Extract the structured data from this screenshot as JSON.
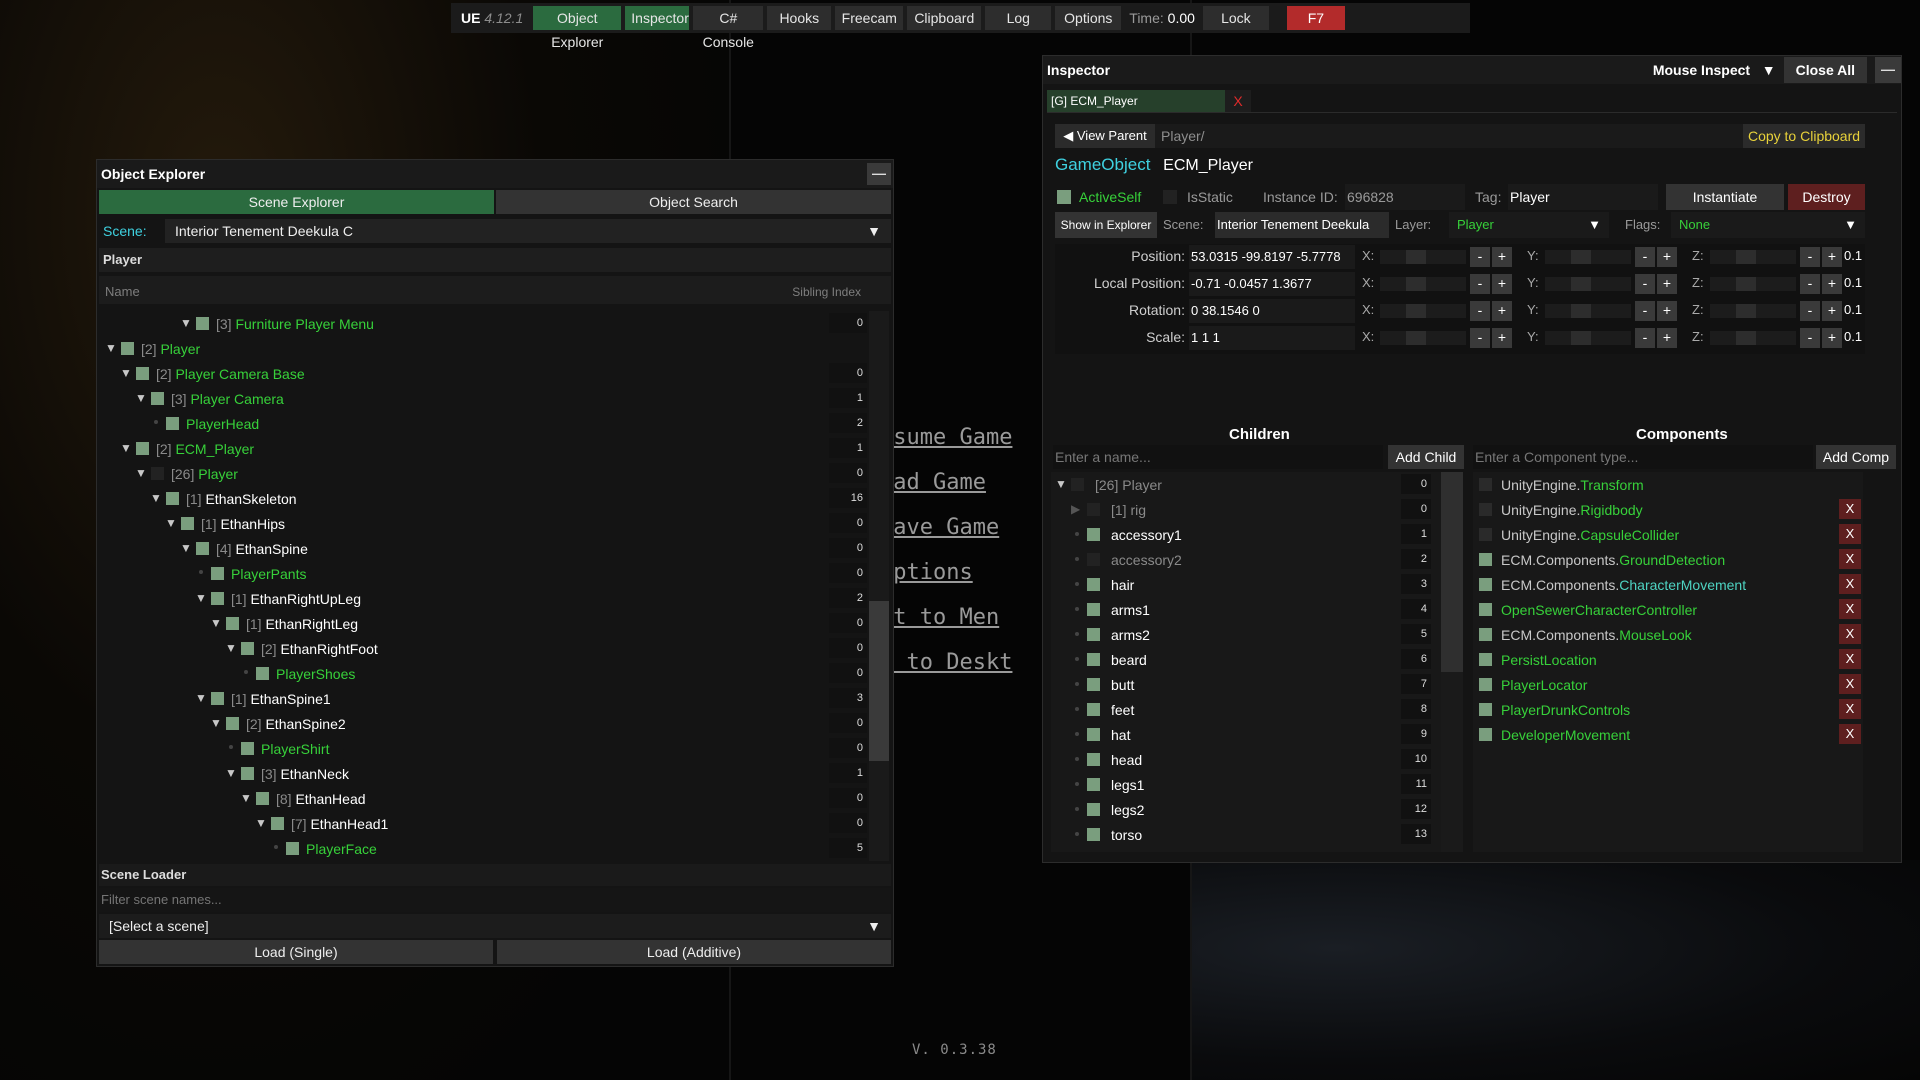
{
  "game_menu": {
    "items": [
      "esume Game",
      "oad Game",
      "Save Game",
      "Options",
      "it to Men",
      "t to Deskt"
    ],
    "version": "V. 0.3.38"
  },
  "topbar": {
    "title": "UE",
    "version": "4.12.1",
    "buttons": [
      "Object Explorer",
      "Inspector",
      "C# Console",
      "Hooks",
      "Freecam",
      "Clipboard",
      "Log",
      "Options"
    ],
    "active_buttons": [
      "Object Explorer",
      "Inspector"
    ],
    "time_label": "Time:",
    "time_value": "0.00",
    "lock": "Lock",
    "close_key": "F7"
  },
  "object_explorer": {
    "title": "Object Explorer",
    "minimize": "—",
    "tabs": [
      "Scene Explorer",
      "Object Search"
    ],
    "scene_label": "Scene:",
    "scene_value": "Interior Tenement Deekula C",
    "dropdown_arrow": "▼",
    "section": "Player",
    "col_name": "Name",
    "col_sibling": "Sibling Index",
    "tree": [
      {
        "depth": 5,
        "expanded": true,
        "active": true,
        "count": "[3]",
        "name": "Furniture Player Menu",
        "green": true,
        "sib": "0"
      },
      {
        "depth": 0,
        "expanded": true,
        "active": true,
        "count": "[2]",
        "name": "Player",
        "green": true,
        "sib": ""
      },
      {
        "depth": 1,
        "expanded": true,
        "active": true,
        "count": "[2]",
        "name": "Player Camera Base",
        "green": true,
        "sib": "0"
      },
      {
        "depth": 2,
        "expanded": true,
        "active": true,
        "count": "[3]",
        "name": "Player Camera",
        "green": true,
        "sib": "1"
      },
      {
        "depth": 3,
        "expanded": null,
        "active": true,
        "count": "",
        "name": "PlayerHead",
        "green": true,
        "sib": "2"
      },
      {
        "depth": 1,
        "expanded": true,
        "active": true,
        "count": "[2]",
        "name": "ECM_Player",
        "green": true,
        "sib": "1"
      },
      {
        "depth": 2,
        "expanded": true,
        "active": false,
        "count": "[26]",
        "name": "Player",
        "green": true,
        "sib": "0"
      },
      {
        "depth": 3,
        "expanded": true,
        "active": true,
        "count": "[1]",
        "name": "EthanSkeleton",
        "green": false,
        "sib": "16"
      },
      {
        "depth": 4,
        "expanded": true,
        "active": true,
        "count": "[1]",
        "name": "EthanHips",
        "green": false,
        "sib": "0"
      },
      {
        "depth": 5,
        "expanded": true,
        "active": true,
        "count": "[4]",
        "name": "EthanSpine",
        "green": false,
        "sib": "0"
      },
      {
        "depth": 6,
        "expanded": null,
        "active": true,
        "count": "",
        "name": "PlayerPants",
        "green": true,
        "sib": "0"
      },
      {
        "depth": 6,
        "expanded": true,
        "active": true,
        "count": "[1]",
        "name": "EthanRightUpLeg",
        "green": false,
        "sib": "2"
      },
      {
        "depth": 7,
        "expanded": true,
        "active": true,
        "count": "[1]",
        "name": "EthanRightLeg",
        "green": false,
        "sib": "0"
      },
      {
        "depth": 8,
        "expanded": true,
        "active": true,
        "count": "[2]",
        "name": "EthanRightFoot",
        "green": false,
        "sib": "0"
      },
      {
        "depth": 9,
        "expanded": null,
        "active": true,
        "count": "",
        "name": "PlayerShoes",
        "green": true,
        "sib": "0"
      },
      {
        "depth": 6,
        "expanded": true,
        "active": true,
        "count": "[1]",
        "name": "EthanSpine1",
        "green": false,
        "sib": "3"
      },
      {
        "depth": 7,
        "expanded": true,
        "active": true,
        "count": "[2]",
        "name": "EthanSpine2",
        "green": false,
        "sib": "0"
      },
      {
        "depth": 8,
        "expanded": null,
        "active": true,
        "count": "",
        "name": "PlayerShirt",
        "green": true,
        "sib": "0"
      },
      {
        "depth": 8,
        "expanded": true,
        "active": true,
        "count": "[3]",
        "name": "EthanNeck",
        "green": false,
        "sib": "1"
      },
      {
        "depth": 9,
        "expanded": true,
        "active": true,
        "count": "[8]",
        "name": "EthanHead",
        "green": false,
        "sib": "0"
      },
      {
        "depth": 10,
        "expanded": true,
        "active": true,
        "count": "[7]",
        "name": "EthanHead1",
        "green": false,
        "sib": "0"
      },
      {
        "depth": 11,
        "expanded": null,
        "active": true,
        "count": "",
        "name": "PlayerFace",
        "green": true,
        "sib": "5"
      }
    ],
    "loader_title": "Scene Loader",
    "loader_filter_placeholder": "Filter scene names...",
    "loader_select": "[Select a scene]",
    "load_single": "Load (Single)",
    "load_additive": "Load (Additive)"
  },
  "inspector": {
    "title": "Inspector",
    "mouse_inspect": "Mouse Inspect",
    "mouse_inspect_arrow": "▼",
    "close_all": "Close All",
    "minimize": "—",
    "tab_label": "[G] ECM_Player",
    "tab_close": "X",
    "view_parent": "◀ View Parent",
    "path": "Player/",
    "copy": "Copy to Clipboard",
    "go_type": "GameObject",
    "go_name": "ECM_Player",
    "active_self": "ActiveSelf",
    "is_static": "IsStatic",
    "instance_id_label": "Instance ID:",
    "instance_id": "696828",
    "tag_label": "Tag:",
    "tag": "Player",
    "instantiate": "Instantiate",
    "destroy": "Destroy",
    "show_in_explorer": "Show in Explorer",
    "scene_label": "Scene:",
    "scene": "Interior Tenement Deekula",
    "layer_label": "Layer:",
    "layer": "Player",
    "flags_label": "Flags:",
    "flags": "None",
    "transform": [
      {
        "label": "Position:",
        "value": "53.0315 -99.8197 -5.7778"
      },
      {
        "label": "Local Position:",
        "value": "-0.71 -0.0457 1.3677"
      },
      {
        "label": "Rotation:",
        "value": "0 38.1546 0"
      },
      {
        "label": "Scale:",
        "value": "1 1 1"
      }
    ],
    "axes": [
      "X:",
      "Y:",
      "Z:"
    ],
    "minus": "-",
    "plus": "+",
    "step": "0.1",
    "children_title": "Children",
    "children_placeholder": "Enter a name...",
    "add_child": "Add Child",
    "components_title": "Components",
    "components_placeholder": "Enter a Component type...",
    "add_comp": "Add Comp",
    "children": [
      {
        "expanded": true,
        "arrow": true,
        "active": false,
        "name": "[26] Player",
        "dim": true,
        "sib": "0"
      },
      {
        "expanded": false,
        "arrow": true,
        "active": false,
        "name": "[1] rig",
        "dim": true,
        "sib": "0"
      },
      {
        "expanded": null,
        "arrow": false,
        "active": true,
        "name": "accessory1",
        "dim": false,
        "sib": "1"
      },
      {
        "expanded": null,
        "arrow": false,
        "active": false,
        "name": "accessory2",
        "dim": true,
        "sib": "2"
      },
      {
        "expanded": null,
        "arrow": false,
        "active": true,
        "name": "hair",
        "dim": false,
        "sib": "3"
      },
      {
        "expanded": null,
        "arrow": false,
        "active": true,
        "name": "arms1",
        "dim": false,
        "sib": "4"
      },
      {
        "expanded": null,
        "arrow": false,
        "active": true,
        "name": "arms2",
        "dim": false,
        "sib": "5"
      },
      {
        "expanded": null,
        "arrow": false,
        "active": true,
        "name": "beard",
        "dim": false,
        "sib": "6"
      },
      {
        "expanded": null,
        "arrow": false,
        "active": true,
        "name": "butt",
        "dim": false,
        "sib": "7"
      },
      {
        "expanded": null,
        "arrow": false,
        "active": true,
        "name": "feet",
        "dim": false,
        "sib": "8"
      },
      {
        "expanded": null,
        "arrow": false,
        "active": true,
        "name": "hat",
        "dim": false,
        "sib": "9"
      },
      {
        "expanded": null,
        "arrow": false,
        "active": true,
        "name": "head",
        "dim": false,
        "sib": "10"
      },
      {
        "expanded": null,
        "arrow": false,
        "active": true,
        "name": "legs1",
        "dim": false,
        "sib": "11"
      },
      {
        "expanded": null,
        "arrow": false,
        "active": true,
        "name": "legs2",
        "dim": false,
        "sib": "12"
      },
      {
        "expanded": null,
        "arrow": false,
        "active": true,
        "name": "torso",
        "dim": false,
        "sib": "13"
      }
    ],
    "components": [
      {
        "ns": "UnityEngine.",
        "cls": "Transform",
        "active": false,
        "removable": false,
        "color": "green"
      },
      {
        "ns": "UnityEngine.",
        "cls": "Rigidbody",
        "active": false,
        "removable": true,
        "color": "green"
      },
      {
        "ns": "UnityEngine.",
        "cls": "CapsuleCollider",
        "active": false,
        "removable": true,
        "color": "green"
      },
      {
        "ns": "ECM.Components.",
        "cls": "GroundDetection",
        "active": true,
        "removable": true,
        "color": "green"
      },
      {
        "ns": "ECM.Components.",
        "cls": "CharacterMovement",
        "active": true,
        "removable": true,
        "color": "cyan"
      },
      {
        "ns": "",
        "cls": "OpenSewerCharacterController",
        "active": true,
        "removable": true,
        "color": "green"
      },
      {
        "ns": "ECM.Components.",
        "cls": "MouseLook",
        "active": true,
        "removable": true,
        "color": "green"
      },
      {
        "ns": "",
        "cls": "PersistLocation",
        "active": true,
        "removable": true,
        "color": "green"
      },
      {
        "ns": "",
        "cls": "PlayerLocator",
        "active": true,
        "removable": true,
        "color": "green"
      },
      {
        "ns": "",
        "cls": "PlayerDrunkControls",
        "active": true,
        "removable": true,
        "color": "green"
      },
      {
        "ns": "",
        "cls": "DeveloperMovement",
        "active": true,
        "removable": true,
        "color": "green"
      }
    ],
    "remove": "X"
  }
}
